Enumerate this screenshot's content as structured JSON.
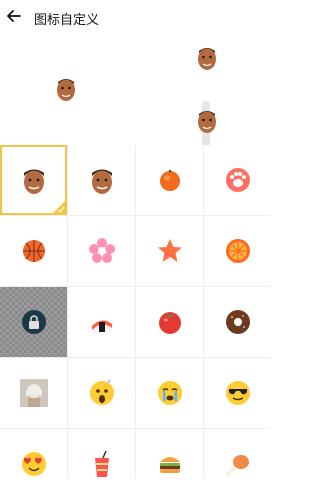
{
  "header": {
    "title": "图标自定义"
  },
  "icons": {
    "back": "back-arrow-icon",
    "grid": [
      "face-photo-icon",
      "face-photo-icon",
      "orange-fruit-icon",
      "paw-icon",
      "basketball-icon",
      "flower-icon",
      "star-icon",
      "orange-slice-icon",
      "lock-icon",
      "sushi-icon",
      "tomato-icon",
      "donut-icon",
      "photo-girl-icon",
      "scared-emoji-icon",
      "crying-emoji-icon",
      "sunglasses-emoji-icon",
      "heart-eyes-emoji-icon",
      "drink-cup-icon",
      "burger-icon",
      "chicken-leg-icon"
    ]
  },
  "colors": {
    "accent": "#f4c542",
    "grid_bg": "#eeeeee"
  }
}
